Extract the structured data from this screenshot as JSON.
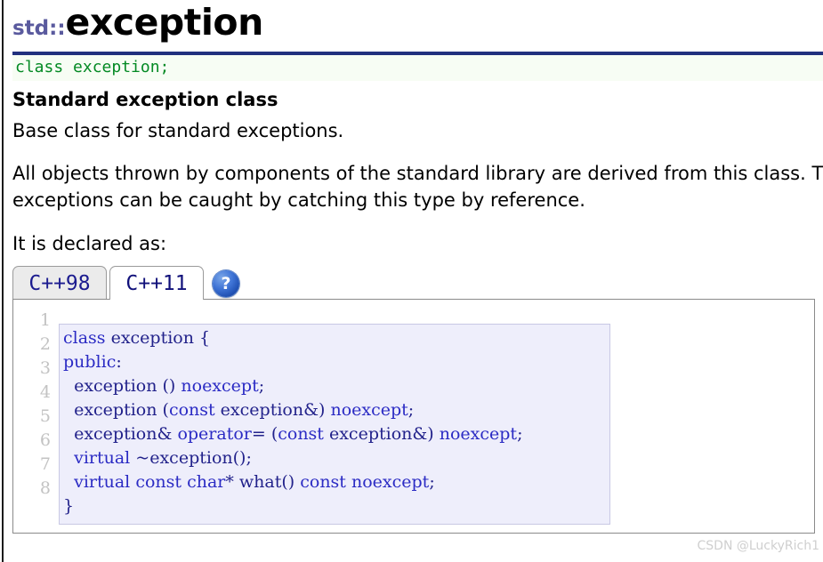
{
  "page": {
    "namespace_prefix": "std::",
    "title": "exception",
    "declaration": "class exception;",
    "subheading": "Standard exception class",
    "summary": "Base class for standard exceptions.",
    "description": "All objects thrown by components of the standard library are derived from this class. Therefore, all standard exceptions can be caught by catching this type by reference.",
    "declared_as_label": "It is declared as:"
  },
  "tabs": [
    {
      "label": "C++98",
      "active": false
    },
    {
      "label": "C++11",
      "active": true
    }
  ],
  "help": {
    "icon": "help-question-icon",
    "glyph": "?"
  },
  "code": {
    "line_numbers": [
      "1",
      "2",
      "3",
      "4",
      "5",
      "6",
      "7",
      "8"
    ],
    "lines": [
      "class exception {",
      "public:",
      "  exception () noexcept;",
      "  exception (const exception&) noexcept;",
      "  exception& operator= (const exception&) noexcept;",
      "  virtual ~exception();",
      "  virtual const char* what() const noexcept;",
      "}"
    ],
    "text": "class exception {\npublic:\n  exception () noexcept;\n  exception (const exception&) noexcept;\n  exception& operator= (const exception&) noexcept;\n  virtual ~exception();\n  virtual const char* what() const noexcept;\n}"
  },
  "watermark": {
    "text": "CSDN @LuckyRich1"
  },
  "colors": {
    "title_rule": "#21307e",
    "namespace": "#5a5a9e",
    "declaration_text": "#048a24",
    "declaration_bg": "#f7fdf4",
    "code_bg": "#eeeefb",
    "code_text": "#22228b",
    "tab_active_bg": "#ffffff",
    "tab_inactive_bg": "#ebebeb",
    "help_icon_blue": "#2152b4",
    "watermark": "#cfcfcf"
  }
}
